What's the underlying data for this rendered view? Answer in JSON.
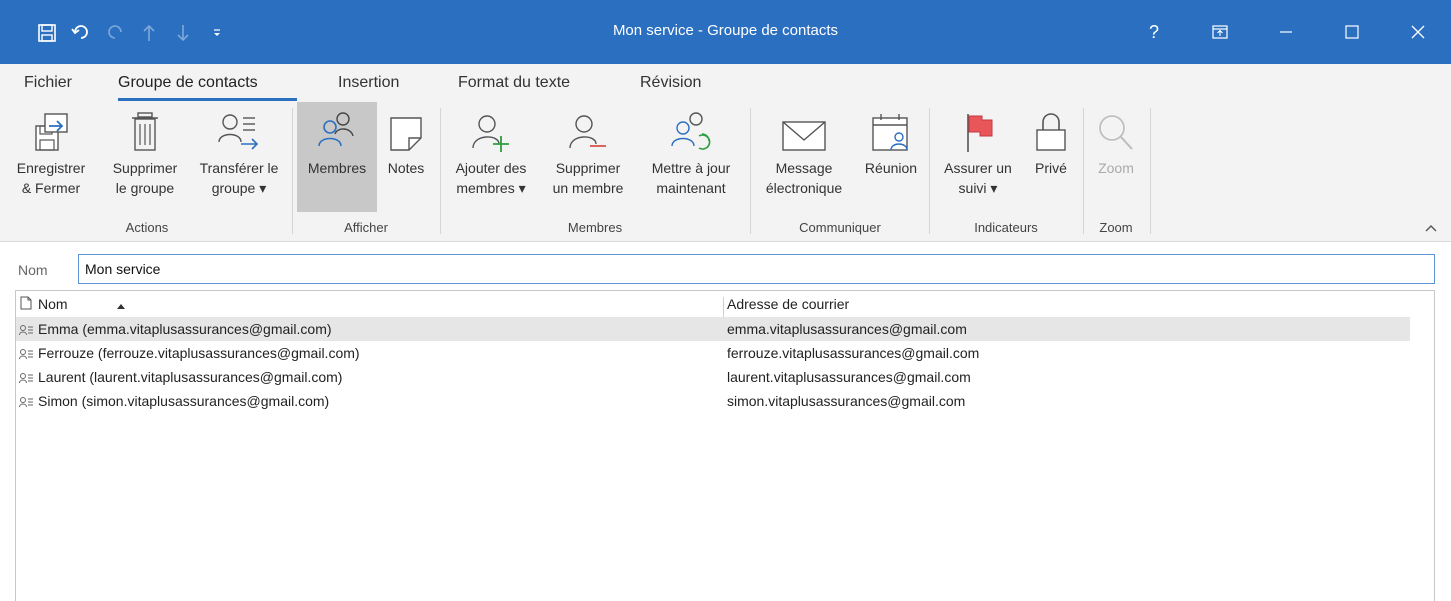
{
  "window": {
    "title": "Mon service  -  Groupe de contacts",
    "help_label": "?"
  },
  "tabs": [
    "Fichier",
    "Groupe de contacts",
    "Insertion",
    "Format du texte",
    "Révision"
  ],
  "ribbon": {
    "actions": {
      "group_label": "Actions",
      "save_close": [
        "Enregistrer",
        "& Fermer"
      ],
      "delete_group": [
        "Supprimer",
        "le groupe"
      ],
      "forward_group": [
        "Transférer le",
        "groupe ▾"
      ]
    },
    "show": {
      "group_label": "Afficher",
      "members": "Membres",
      "notes": "Notes"
    },
    "members": {
      "group_label": "Membres",
      "add_members": [
        "Ajouter des",
        "membres ▾"
      ],
      "remove_member": [
        "Supprimer",
        "un membre"
      ],
      "update_now": [
        "Mettre à jour",
        "maintenant"
      ]
    },
    "communicate": {
      "group_label": "Communiquer",
      "email_message": [
        "Message",
        "électronique"
      ],
      "meeting": "Réunion"
    },
    "tags": {
      "group_label": "Indicateurs",
      "follow_up": [
        "Assurer un",
        "suivi ▾"
      ],
      "private": "Privé"
    },
    "zoom": {
      "group_label": "Zoom",
      "zoom": "Zoom"
    }
  },
  "name_field": {
    "label": "Nom",
    "value": "Mon service"
  },
  "member_list": {
    "columns": [
      "Nom",
      "Adresse de courrier"
    ],
    "rows": [
      {
        "name": "Emma (emma.vitaplusassurances@gmail.com)",
        "email": "emma.vitaplusassurances@gmail.com",
        "selected": true
      },
      {
        "name": "Ferrouze (ferrouze.vitaplusassurances@gmail.com)",
        "email": "ferrouze.vitaplusassurances@gmail.com",
        "selected": false
      },
      {
        "name": "Laurent (laurent.vitaplusassurances@gmail.com)",
        "email": "laurent.vitaplusassurances@gmail.com",
        "selected": false
      },
      {
        "name": "Simon (simon.vitaplusassurances@gmail.com)",
        "email": "simon.vitaplusassurances@gmail.com",
        "selected": false
      }
    ]
  },
  "colors": {
    "title_bar": "#2b6fc1",
    "accent": "#2b6fc1",
    "add_green": "#2e9e3e",
    "remove_red": "#d9534f",
    "flag_red": "#e8565a"
  }
}
